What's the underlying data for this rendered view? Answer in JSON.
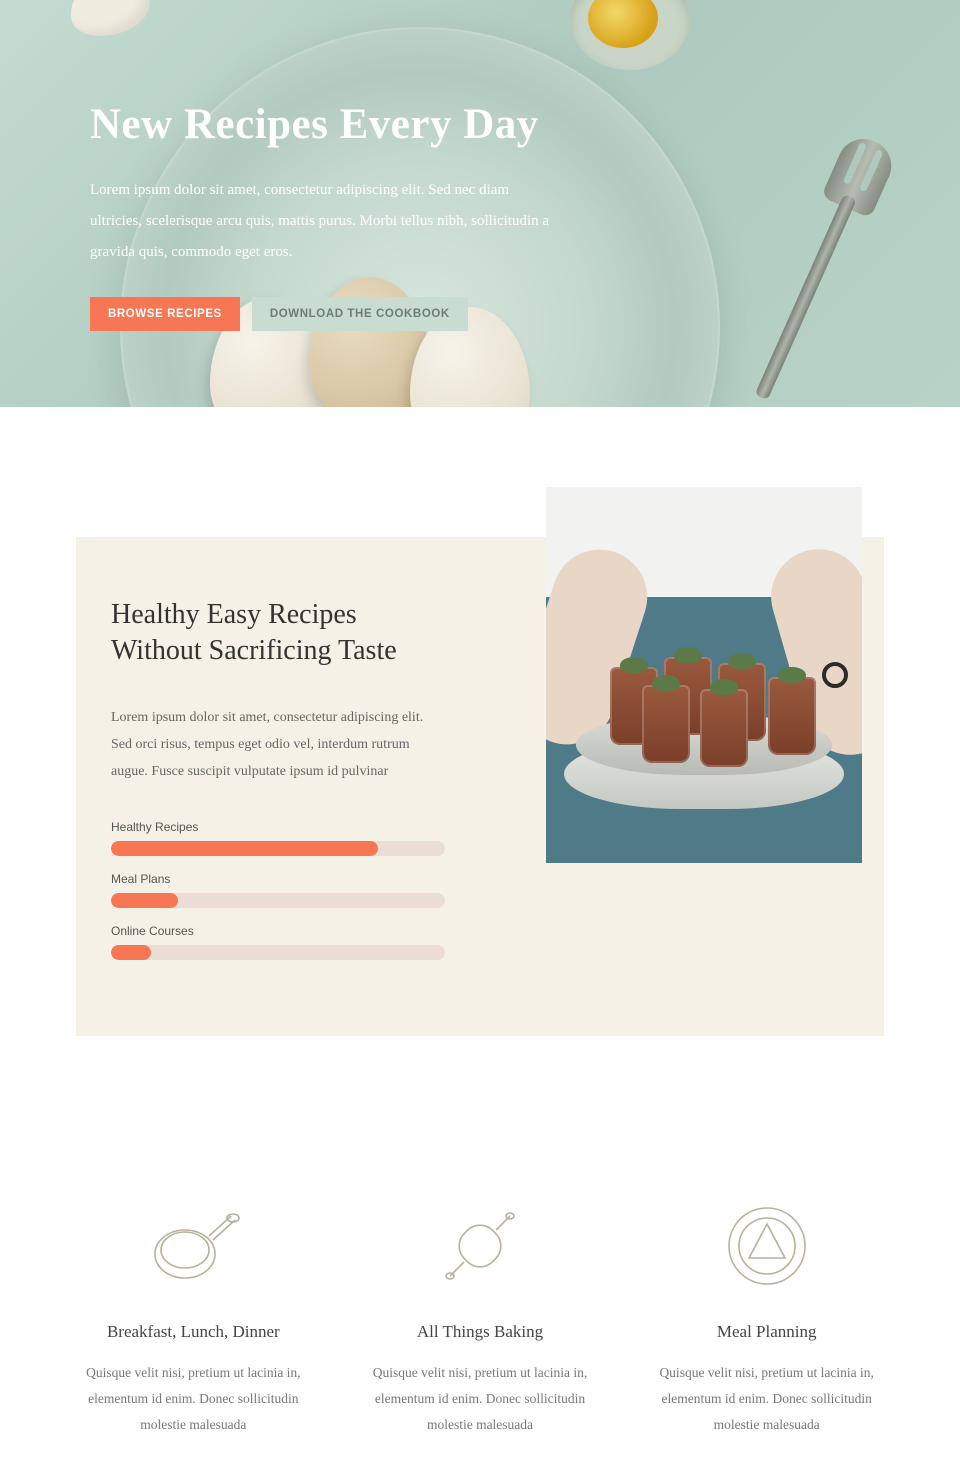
{
  "hero": {
    "title": "New Recipes Every Day",
    "subtitle": "Lorem ipsum dolor sit amet, consectetur adipiscing elit. Sed nec diam ultricies, scelerisque arcu quis, mattis purus. Morbi tellus nibh, sollicitudin a gravida quis, commodo eget eros.",
    "primary_button": "BROWSE RECIPES",
    "secondary_button": "DOWNLOAD THE COOKBOOK"
  },
  "about": {
    "heading": "Healthy Easy Recipes Without Sacrificing Taste",
    "body": "Lorem ipsum dolor sit amet, consectetur adipiscing elit. Sed orci risus, tempus eget odio vel, interdum rutrum augue. Fusce suscipit vulputate ipsum id pulvinar",
    "bars": [
      {
        "label": "Healthy Recipes",
        "percent": 80
      },
      {
        "label": "Meal Plans",
        "percent": 20
      },
      {
        "label": "Online Courses",
        "percent": 12
      }
    ]
  },
  "features": [
    {
      "title": "Breakfast, Lunch, Dinner",
      "body": "Quisque velit nisi, pretium ut lacinia in, elementum id enim. Donec sollicitudin molestie malesuada"
    },
    {
      "title": "All Things Baking",
      "body": "Quisque velit nisi, pretium ut lacinia in, elementum id enim. Donec sollicitudin molestie malesuada"
    },
    {
      "title": "Meal Planning",
      "body": "Quisque velit nisi, pretium ut lacinia in, elementum id enim. Donec sollicitudin molestie malesuada"
    }
  ]
}
